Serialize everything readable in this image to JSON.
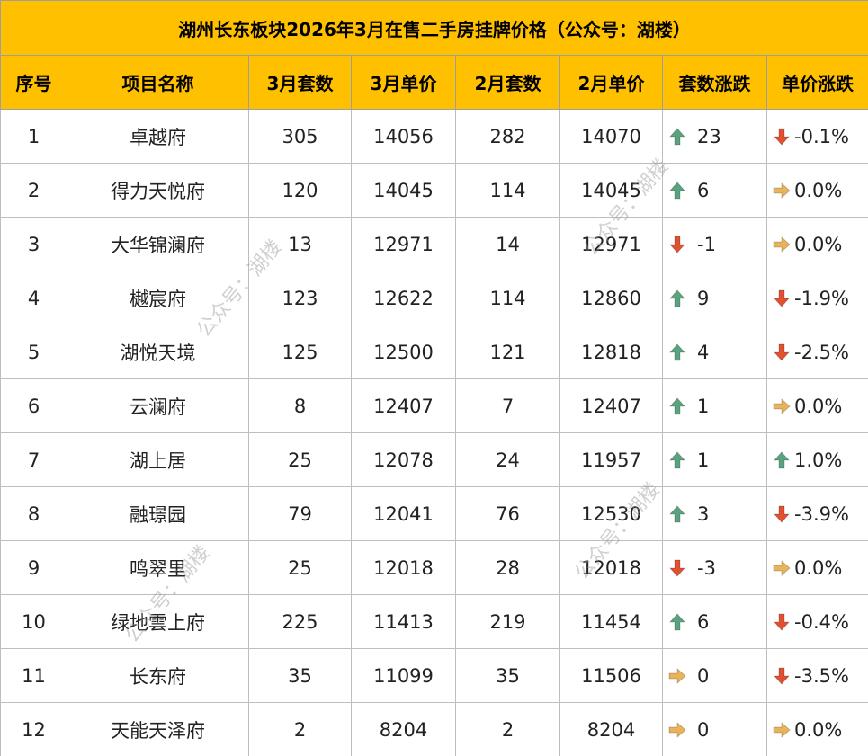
{
  "title": "湖州长东板块2026年3月在售二手房挂牌价格（公众号：湖楼）",
  "headers": [
    "序号",
    "项目名称",
    "3月套数",
    "3月单价",
    "2月套数",
    "2月单价",
    "套数涨跌",
    "单价涨跌"
  ],
  "watermark_text": "公众号：湖楼",
  "colors": {
    "header_bg": "#ffc000",
    "up": "#5aa37f",
    "down": "#e2502f",
    "flat": "#e8b35a"
  },
  "rows": [
    {
      "no": "1",
      "name": "卓越府",
      "mar_count": "305",
      "mar_price": "14056",
      "feb_count": "282",
      "feb_price": "14070",
      "count_change": "23",
      "count_dir": "up",
      "price_change": "-0.1%",
      "price_dir": "down"
    },
    {
      "no": "2",
      "name": "得力天悦府",
      "mar_count": "120",
      "mar_price": "14045",
      "feb_count": "114",
      "feb_price": "14045",
      "count_change": "6",
      "count_dir": "up",
      "price_change": "0.0%",
      "price_dir": "flat"
    },
    {
      "no": "3",
      "name": "大华锦澜府",
      "mar_count": "13",
      "mar_price": "12971",
      "feb_count": "14",
      "feb_price": "12971",
      "count_change": "-1",
      "count_dir": "down",
      "price_change": "0.0%",
      "price_dir": "flat"
    },
    {
      "no": "4",
      "name": "樾宸府",
      "mar_count": "123",
      "mar_price": "12622",
      "feb_count": "114",
      "feb_price": "12860",
      "count_change": "9",
      "count_dir": "up",
      "price_change": "-1.9%",
      "price_dir": "down"
    },
    {
      "no": "5",
      "name": "湖悦天境",
      "mar_count": "125",
      "mar_price": "12500",
      "feb_count": "121",
      "feb_price": "12818",
      "count_change": "4",
      "count_dir": "up",
      "price_change": "-2.5%",
      "price_dir": "down"
    },
    {
      "no": "6",
      "name": "云澜府",
      "mar_count": "8",
      "mar_price": "12407",
      "feb_count": "7",
      "feb_price": "12407",
      "count_change": "1",
      "count_dir": "up",
      "price_change": "0.0%",
      "price_dir": "flat"
    },
    {
      "no": "7",
      "name": "湖上居",
      "mar_count": "25",
      "mar_price": "12078",
      "feb_count": "24",
      "feb_price": "11957",
      "count_change": "1",
      "count_dir": "up",
      "price_change": "1.0%",
      "price_dir": "up"
    },
    {
      "no": "8",
      "name": "融璟园",
      "mar_count": "79",
      "mar_price": "12041",
      "feb_count": "76",
      "feb_price": "12530",
      "count_change": "3",
      "count_dir": "up",
      "price_change": "-3.9%",
      "price_dir": "down"
    },
    {
      "no": "9",
      "name": "鸣翠里",
      "mar_count": "25",
      "mar_price": "12018",
      "feb_count": "28",
      "feb_price": "12018",
      "count_change": "-3",
      "count_dir": "down",
      "price_change": "0.0%",
      "price_dir": "flat"
    },
    {
      "no": "10",
      "name": "绿地雲上府",
      "mar_count": "225",
      "mar_price": "11413",
      "feb_count": "219",
      "feb_price": "11454",
      "count_change": "6",
      "count_dir": "up",
      "price_change": "-0.4%",
      "price_dir": "down"
    },
    {
      "no": "11",
      "name": "长东府",
      "mar_count": "35",
      "mar_price": "11099",
      "feb_count": "35",
      "feb_price": "11506",
      "count_change": "0",
      "count_dir": "flat",
      "price_change": "-3.5%",
      "price_dir": "down"
    },
    {
      "no": "12",
      "name": "天能天泽府",
      "mar_count": "2",
      "mar_price": "8204",
      "feb_count": "2",
      "feb_price": "8204",
      "count_change": "0",
      "count_dir": "flat",
      "price_change": "0.0%",
      "price_dir": "flat"
    }
  ]
}
